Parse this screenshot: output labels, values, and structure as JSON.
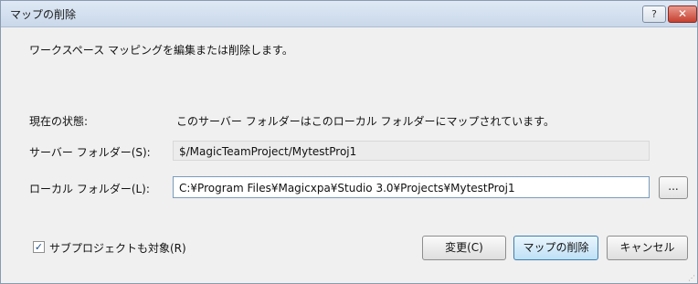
{
  "dialog": {
    "title": "マップの削除",
    "help_label": "?",
    "close_label": "✕"
  },
  "description": "ワークスペース マッピングを編集または削除します。",
  "status": {
    "label": "現在の状態:",
    "value": "このサーバー フォルダーはこのローカル フォルダーにマップされています。"
  },
  "server_folder": {
    "label": "サーバー フォルダー(S):",
    "value": "$/MagicTeamProject/MytestProj1"
  },
  "local_folder": {
    "label": "ローカル フォルダー(L):",
    "value": "C:¥Program Files¥Magicxpa¥Studio 3.0¥Projects¥MytestProj1",
    "browse_label": "..."
  },
  "subprojects": {
    "label": "サブプロジェクトも対象(R)",
    "checked": true,
    "check_mark": "✓"
  },
  "buttons": {
    "change": "変更(C)",
    "remove": "マップの削除",
    "cancel": "キャンセル"
  }
}
